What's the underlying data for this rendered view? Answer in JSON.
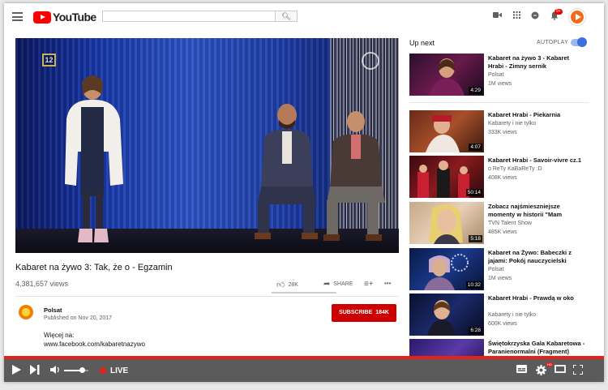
{
  "header": {
    "logo_text": "YouTube",
    "search_placeholder": "",
    "icons": [
      "menu-icon",
      "search-icon",
      "video-camera-icon",
      "apps-icon",
      "messages-icon",
      "notifications-icon",
      "avatar"
    ],
    "notification_count": "9+"
  },
  "video": {
    "channel_badge": "12",
    "title": "Kabaret na żywo 3: Tak, że o - Egzamin",
    "views": "4,381,657 views",
    "likes": "28K",
    "share_label": "SHARE",
    "more_label": "•••"
  },
  "channel": {
    "name": "Polsat",
    "published": "Published on Nov 20, 2017",
    "subscribe_label": "SUBSCRIBE",
    "subscriber_count": "184K"
  },
  "description": {
    "line1": "Więcej na:",
    "line2": "www.facebook.com/kabaretnazywo"
  },
  "up_next": {
    "label": "Up next",
    "autoplay_label": "AUTOPLAY",
    "autoplay_on": true
  },
  "recommendations": [
    {
      "title": "Kabaret na żywo 3 - Kabaret Hrabi - Zimny sernik",
      "channel": "Polsat",
      "views": "1M views",
      "duration": "4:29"
    },
    {
      "title": "Kabaret Hrabi - Piekarnia",
      "channel": "Kabarety i nie tylko",
      "views": "333K views",
      "duration": "4:07"
    },
    {
      "title": "Kabaret Hrabi - Savoir-vivre cz.1",
      "channel": "o ReTy KaBaReTy :D",
      "views": "408K views",
      "duration": "50:14"
    },
    {
      "title": "Zobacz najśmieszniejsze momenty w historii \"Mam",
      "channel": "TVN Talent Show",
      "views": "485K views",
      "duration": "5:18"
    },
    {
      "title": "Kabaret na Żywo: Babeczki z jajami: Pokój nauczycielski",
      "channel": "Polsat",
      "views": "1M views",
      "duration": "10:32"
    },
    {
      "title": "Kabaret Hrabi - Prawdą w oko",
      "channel": "Kabarety i nie tylko",
      "views": "600K views",
      "duration": "6:28"
    },
    {
      "title": "Świętokrzyska Gala Kabaretowa - Paranienormalni (Fragment)",
      "channel": "",
      "views": "",
      "duration": ""
    }
  ],
  "player": {
    "live_label": "LIVE",
    "volume": 0.75,
    "hd_badge": "HD"
  }
}
